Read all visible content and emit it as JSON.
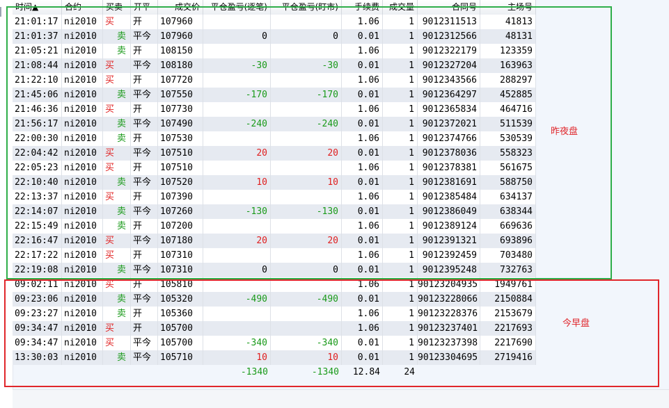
{
  "colors": {
    "buy": "#e02020",
    "sell": "#1a9a1a",
    "box_night": "#2fae4a",
    "box_morning": "#e0262b"
  },
  "header": {
    "columns": [
      "时间▲",
      "合约",
      "买卖",
      "开平",
      "成交价",
      "平仓盈亏(逐笔)",
      "平仓盈亏(盯市)",
      "手续费",
      "成交量",
      "合同号",
      "主场号"
    ]
  },
  "rows": [
    {
      "time": "21:01:17",
      "contract": "ni2010",
      "side": "买",
      "oc": "开",
      "price": "107960",
      "pnl_trade": "",
      "pnl_mark": "",
      "fee": "1.06",
      "vol": "1",
      "contract_no": "9012311513",
      "exch_no": "41813"
    },
    {
      "time": "21:01:37",
      "contract": "ni2010",
      "side": "卖",
      "oc": "平今",
      "price": "107960",
      "pnl_trade": "0",
      "pnl_mark": "0",
      "fee": "0.01",
      "vol": "1",
      "contract_no": "9012312566",
      "exch_no": "48131"
    },
    {
      "time": "21:05:21",
      "contract": "ni2010",
      "side": "卖",
      "oc": "开",
      "price": "108150",
      "pnl_trade": "",
      "pnl_mark": "",
      "fee": "1.06",
      "vol": "1",
      "contract_no": "9012322179",
      "exch_no": "123359"
    },
    {
      "time": "21:08:44",
      "contract": "ni2010",
      "side": "买",
      "oc": "平今",
      "price": "108180",
      "pnl_trade": "-30",
      "pnl_mark": "-30",
      "fee": "0.01",
      "vol": "1",
      "contract_no": "9012327204",
      "exch_no": "163963"
    },
    {
      "time": "21:22:10",
      "contract": "ni2010",
      "side": "买",
      "oc": "开",
      "price": "107720",
      "pnl_trade": "",
      "pnl_mark": "",
      "fee": "1.06",
      "vol": "1",
      "contract_no": "9012343566",
      "exch_no": "288297"
    },
    {
      "time": "21:45:06",
      "contract": "ni2010",
      "side": "卖",
      "oc": "平今",
      "price": "107550",
      "pnl_trade": "-170",
      "pnl_mark": "-170",
      "fee": "0.01",
      "vol": "1",
      "contract_no": "9012364297",
      "exch_no": "452885"
    },
    {
      "time": "21:46:36",
      "contract": "ni2010",
      "side": "买",
      "oc": "开",
      "price": "107730",
      "pnl_trade": "",
      "pnl_mark": "",
      "fee": "1.06",
      "vol": "1",
      "contract_no": "9012365834",
      "exch_no": "464716"
    },
    {
      "time": "21:56:17",
      "contract": "ni2010",
      "side": "卖",
      "oc": "平今",
      "price": "107490",
      "pnl_trade": "-240",
      "pnl_mark": "-240",
      "fee": "0.01",
      "vol": "1",
      "contract_no": "9012372021",
      "exch_no": "511539"
    },
    {
      "time": "22:00:30",
      "contract": "ni2010",
      "side": "卖",
      "oc": "开",
      "price": "107530",
      "pnl_trade": "",
      "pnl_mark": "",
      "fee": "1.06",
      "vol": "1",
      "contract_no": "9012374766",
      "exch_no": "530539"
    },
    {
      "time": "22:04:42",
      "contract": "ni2010",
      "side": "买",
      "oc": "平今",
      "price": "107510",
      "pnl_trade": "20",
      "pnl_mark": "20",
      "fee": "0.01",
      "vol": "1",
      "contract_no": "9012378036",
      "exch_no": "558323"
    },
    {
      "time": "22:05:23",
      "contract": "ni2010",
      "side": "买",
      "oc": "开",
      "price": "107510",
      "pnl_trade": "",
      "pnl_mark": "",
      "fee": "1.06",
      "vol": "1",
      "contract_no": "9012378381",
      "exch_no": "561675"
    },
    {
      "time": "22:10:40",
      "contract": "ni2010",
      "side": "卖",
      "oc": "平今",
      "price": "107520",
      "pnl_trade": "10",
      "pnl_mark": "10",
      "fee": "0.01",
      "vol": "1",
      "contract_no": "9012381691",
      "exch_no": "588750"
    },
    {
      "time": "22:13:37",
      "contract": "ni2010",
      "side": "买",
      "oc": "开",
      "price": "107390",
      "pnl_trade": "",
      "pnl_mark": "",
      "fee": "1.06",
      "vol": "1",
      "contract_no": "9012385484",
      "exch_no": "634137"
    },
    {
      "time": "22:14:07",
      "contract": "ni2010",
      "side": "卖",
      "oc": "平今",
      "price": "107260",
      "pnl_trade": "-130",
      "pnl_mark": "-130",
      "fee": "0.01",
      "vol": "1",
      "contract_no": "9012386049",
      "exch_no": "638344"
    },
    {
      "time": "22:15:49",
      "contract": "ni2010",
      "side": "卖",
      "oc": "开",
      "price": "107200",
      "pnl_trade": "",
      "pnl_mark": "",
      "fee": "1.06",
      "vol": "1",
      "contract_no": "9012389124",
      "exch_no": "669636"
    },
    {
      "time": "22:16:47",
      "contract": "ni2010",
      "side": "买",
      "oc": "平今",
      "price": "107180",
      "pnl_trade": "20",
      "pnl_mark": "20",
      "fee": "0.01",
      "vol": "1",
      "contract_no": "9012391321",
      "exch_no": "693896"
    },
    {
      "time": "22:17:22",
      "contract": "ni2010",
      "side": "买",
      "oc": "开",
      "price": "107310",
      "pnl_trade": "",
      "pnl_mark": "",
      "fee": "1.06",
      "vol": "1",
      "contract_no": "9012392459",
      "exch_no": "703480"
    },
    {
      "time": "22:19:08",
      "contract": "ni2010",
      "side": "卖",
      "oc": "平今",
      "price": "107310",
      "pnl_trade": "0",
      "pnl_mark": "0",
      "fee": "0.01",
      "vol": "1",
      "contract_no": "9012395248",
      "exch_no": "732763"
    },
    {
      "time": "09:02:11",
      "contract": "ni2010",
      "side": "买",
      "oc": "开",
      "price": "105810",
      "pnl_trade": "",
      "pnl_mark": "",
      "fee": "1.06",
      "vol": "1",
      "contract_no": "90123204935",
      "exch_no": "1949761"
    },
    {
      "time": "09:23:06",
      "contract": "ni2010",
      "side": "卖",
      "oc": "平今",
      "price": "105320",
      "pnl_trade": "-490",
      "pnl_mark": "-490",
      "fee": "0.01",
      "vol": "1",
      "contract_no": "90123228066",
      "exch_no": "2150884"
    },
    {
      "time": "09:23:27",
      "contract": "ni2010",
      "side": "卖",
      "oc": "开",
      "price": "105360",
      "pnl_trade": "",
      "pnl_mark": "",
      "fee": "1.06",
      "vol": "1",
      "contract_no": "90123228376",
      "exch_no": "2153679"
    },
    {
      "time": "09:34:47",
      "contract": "ni2010",
      "side": "买",
      "oc": "开",
      "price": "105700",
      "pnl_trade": "",
      "pnl_mark": "",
      "fee": "1.06",
      "vol": "1",
      "contract_no": "90123237401",
      "exch_no": "2217693"
    },
    {
      "time": "09:34:47",
      "contract": "ni2010",
      "side": "买",
      "oc": "平今",
      "price": "105700",
      "pnl_trade": "-340",
      "pnl_mark": "-340",
      "fee": "0.01",
      "vol": "1",
      "contract_no": "90123237398",
      "exch_no": "2217690"
    },
    {
      "time": "13:30:03",
      "contract": "ni2010",
      "side": "卖",
      "oc": "平今",
      "price": "105710",
      "pnl_trade": "10",
      "pnl_mark": "10",
      "fee": "0.01",
      "vol": "1",
      "contract_no": "90123304695",
      "exch_no": "2719416"
    }
  ],
  "totals": {
    "pnl_trade": "-1340",
    "pnl_mark": "-1340",
    "fee": "12.84",
    "vol": "24"
  },
  "annotations": {
    "night": "昨夜盘",
    "morning": "今早盘"
  }
}
